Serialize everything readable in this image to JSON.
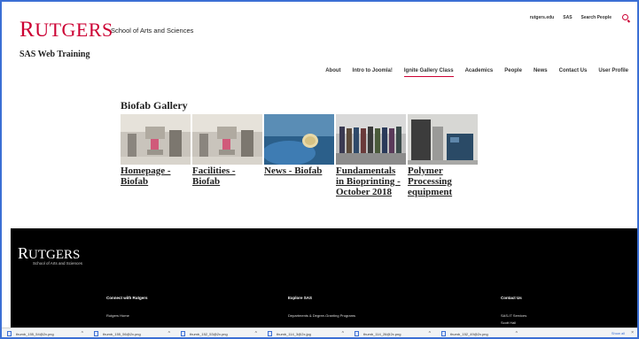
{
  "header": {
    "logo_initial": "R",
    "logo_rest": "UTGERS",
    "logo_subtitle": "School of Arts and Sciences",
    "site_title": "SAS Web Training",
    "utility_links": [
      "rutgers.edu",
      "SAS",
      "Search People"
    ],
    "nav": [
      "About",
      "Intro to Joomla!",
      "Ignite Gallery Class",
      "Academics",
      "People",
      "News",
      "Contact Us",
      "User Profile"
    ],
    "active_nav": "Ignite Gallery Class"
  },
  "gallery": {
    "title": "Biofab Gallery",
    "items": [
      {
        "label": "Homepage - Biofab",
        "image": "lab-equipment-photo"
      },
      {
        "label": "Facilities - Biofab",
        "image": "lab-equipment-photo"
      },
      {
        "label": "News - Biofab",
        "image": "gloved-hand-sample-photo"
      },
      {
        "label": "Fundamentals in Bioprinting - October 2018",
        "image": "group-photo"
      },
      {
        "label": "Polymer Processing equipment",
        "image": "machinery-photo"
      }
    ]
  },
  "footer": {
    "logo_initial": "R",
    "logo_rest": "UTGERS",
    "logo_subtitle": "School of Arts and Sciences",
    "columns": [
      {
        "heading": "Connect with Rutgers",
        "links": [
          "Rutgers Home"
        ]
      },
      {
        "heading": "Explore SAS",
        "links": [
          "Departments & Degree-Granting Programs"
        ]
      },
      {
        "heading": "Contact Us",
        "links": [
          "SAS-IT Services",
          "Scott Hall"
        ]
      }
    ]
  },
  "downloads": {
    "files": [
      "thumb_155_54@2x.png",
      "thumb_155_56@2x.png",
      "thumb_152_53@2x.png",
      "thumb_114_3@2x.jpg",
      "thumb_114_26@2x.png",
      "thumb_152_49@2x.png"
    ],
    "show_all": "Show all",
    "close": "×"
  },
  "colors": {
    "accent": "#cc0033",
    "footer_bg": "#000000",
    "frame": "#3b6fd4"
  }
}
